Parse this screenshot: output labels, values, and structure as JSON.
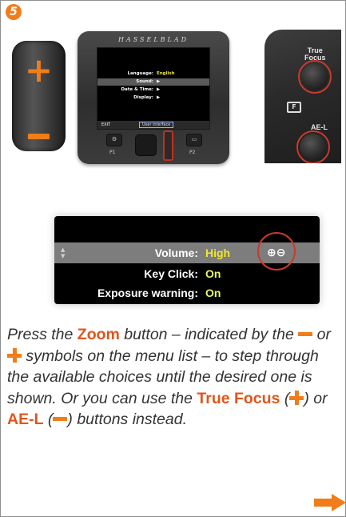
{
  "step": {
    "number": "5"
  },
  "rocker": {
    "plus": "+",
    "minus": "–"
  },
  "camera_back": {
    "brand": "HASSELBLAD",
    "screen": {
      "rows": [
        {
          "label": "Language:",
          "value": "English"
        },
        {
          "label": "Sound:",
          "value": "▶"
        },
        {
          "label": "Date & Time:",
          "value": "▶"
        },
        {
          "label": "Display:",
          "value": "▶"
        }
      ],
      "exit": "EXIT",
      "tab": "User interface"
    },
    "buttons": {
      "left_label": "P1",
      "right_label": "P2"
    }
  },
  "grip": {
    "true_focus": "True\nFocus",
    "ael": "AE-L"
  },
  "menu": {
    "rows": [
      {
        "label": "Volume:",
        "value": "High"
      },
      {
        "label": "Key Click:",
        "value": "On"
      },
      {
        "label": "Exposure warning:",
        "value": "On"
      }
    ],
    "zoom_icons": "⊕⊖"
  },
  "instructions": {
    "p1": "Press the ",
    "zoom": "Zoom",
    "p2": " button – indicated by the ",
    "p3": " or ",
    "p4": " symbols on the menu list – to step through the available choices until the desired one is shown. Or you can use the ",
    "true_focus": "True Focus",
    "p5": " (",
    "p6": ") or ",
    "ael": "AE-L",
    "p7": " (",
    "p8": ") buttons instead."
  },
  "colors": {
    "accent": "#f07d1a",
    "ring": "#c93a2a",
    "value_yellow": "#f2e62b"
  },
  "icons": {
    "next": "arrow-right-icon"
  }
}
